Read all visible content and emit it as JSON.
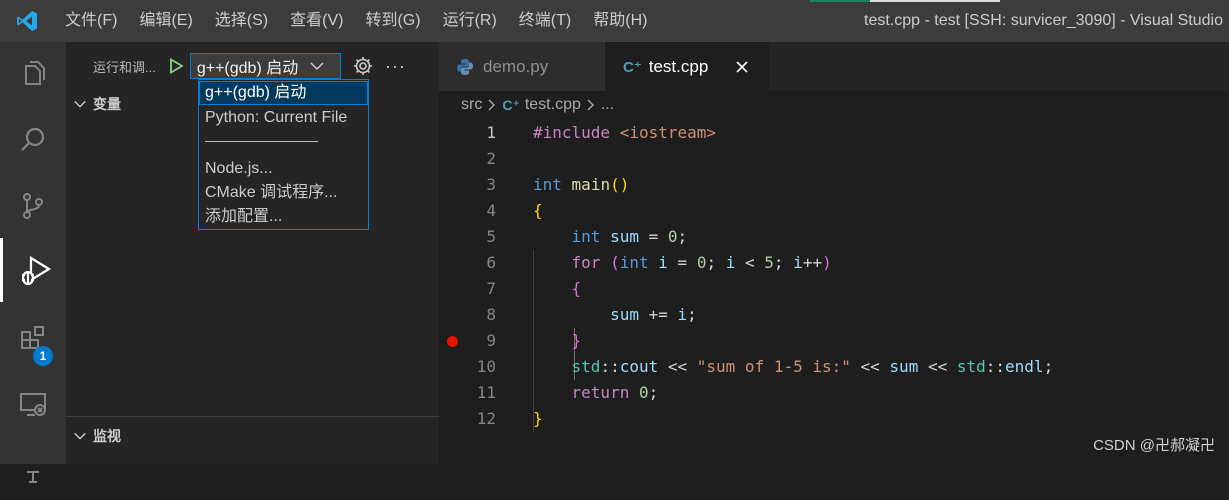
{
  "window": {
    "title": "test.cpp - test [SSH: survicer_3090] - Visual Studio"
  },
  "menu": [
    "文件(F)",
    "编辑(E)",
    "选择(S)",
    "查看(V)",
    "转到(G)",
    "运行(R)",
    "终端(T)",
    "帮助(H)"
  ],
  "activity_bar": {
    "items": [
      "explorer",
      "search",
      "source-control",
      "run-and-debug",
      "extensions",
      "remote-explorer",
      "testing"
    ],
    "extensions_badge": "1"
  },
  "sidebar": {
    "title": "运行和调...",
    "config_selected": "g++(gdb) 启动",
    "sections": {
      "variables": "变量",
      "watch": "监视"
    }
  },
  "dropdown": {
    "options": [
      "g++(gdb) 启动",
      "Python: Current File",
      "Node.js...",
      "CMake 调试程序...",
      "添加配置..."
    ]
  },
  "tabs": [
    {
      "label": "demo.py",
      "active": false
    },
    {
      "label": "test.cpp",
      "active": true
    }
  ],
  "breadcrumb": {
    "folder": "src",
    "file": "test.cpp",
    "symbol": "..."
  },
  "editor": {
    "line_numbers": [
      "1",
      "2",
      "3",
      "4",
      "5",
      "6",
      "7",
      "8",
      "9",
      "10",
      "11",
      "12"
    ],
    "current_line": "1",
    "breakpoint_line": "9"
  },
  "watermark": "CSDN @卍郝凝卍",
  "colors": {
    "accent": "#007acc",
    "breakpoint": "#e51400",
    "titlebar": "#3c3c3c",
    "activitybar": "#333333",
    "sidebar": "#252526",
    "editor": "#1e1e1e"
  }
}
